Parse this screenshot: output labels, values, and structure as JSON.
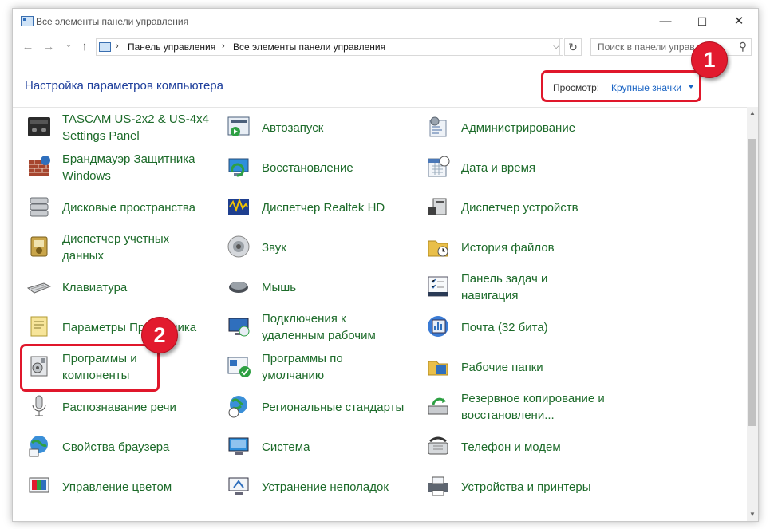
{
  "window": {
    "title": "Все элементы панели управления"
  },
  "winbuttons": {
    "minimize": "—",
    "maximize": "☐",
    "close": "✕"
  },
  "nav": {
    "back": "←",
    "forward": "→",
    "dropdown": "⌄",
    "up": "↑",
    "crumbs": [
      "Панель управления",
      "Все элементы панели управления"
    ],
    "crumb_sep": "›",
    "search_placeholder": "Поиск в панели управ"
  },
  "heading": "Настройка параметров компьютера",
  "view": {
    "label": "Просмотр:",
    "value": "Крупные значки"
  },
  "badges": [
    "1",
    "2"
  ],
  "items": [
    [
      "TASCAM US-2x2 & US-4x4",
      "Settings Panel"
    ],
    [
      "Автозапуск"
    ],
    [
      "Администрирование"
    ],
    [
      "Брандмауэр Защитника",
      "Windows"
    ],
    [
      "Восстановление"
    ],
    [
      "Дата и время"
    ],
    [
      "Дисковые пространства"
    ],
    [
      "Диспетчер Realtek HD"
    ],
    [
      "Диспетчер устройств"
    ],
    [
      "Диспетчер учетных",
      "данных"
    ],
    [
      "Звук"
    ],
    [
      "История файлов"
    ],
    [
      "Клавиатура"
    ],
    [
      "Мышь"
    ],
    [
      "Панель задач и",
      "навигация"
    ],
    [
      "Параметры Проводника"
    ],
    [
      "Подключения к",
      "удаленным рабочим"
    ],
    [
      "Почта (32 бита)"
    ],
    [
      "Программы и",
      "компоненты"
    ],
    [
      "Программы по",
      "умолчанию"
    ],
    [
      "Рабочие папки"
    ],
    [
      "Распознавание речи"
    ],
    [
      "Региональные стандарты"
    ],
    [
      "Резервное копирование и",
      "восстановлени..."
    ],
    [
      "Свойства браузера"
    ],
    [
      "Система"
    ],
    [
      "Телефон и модем"
    ],
    [
      "Управление цветом"
    ],
    [
      "Устранение неполадок"
    ],
    [
      "Устройства и принтеры"
    ]
  ],
  "icons": [
    "tascam-icon",
    "autoplay-icon",
    "admin-tools-icon",
    "firewall-icon",
    "recovery-icon",
    "date-time-icon",
    "storage-spaces-icon",
    "realtek-audio-icon",
    "device-manager-icon",
    "credential-manager-icon",
    "sound-icon",
    "file-history-icon",
    "keyboard-icon",
    "mouse-icon",
    "taskbar-icon",
    "explorer-options-icon",
    "remote-desktop-icon",
    "mail-icon",
    "programs-features-icon",
    "default-programs-icon",
    "work-folders-icon",
    "speech-recognition-icon",
    "region-icon",
    "backup-restore-icon",
    "internet-options-icon",
    "system-icon",
    "phone-modem-icon",
    "color-management-icon",
    "troubleshooting-icon",
    "devices-printers-icon"
  ],
  "colors": {
    "link_green": "#1d6b2a",
    "heading_blue": "#1e3f9c",
    "highlight_red": "#e0172b"
  }
}
